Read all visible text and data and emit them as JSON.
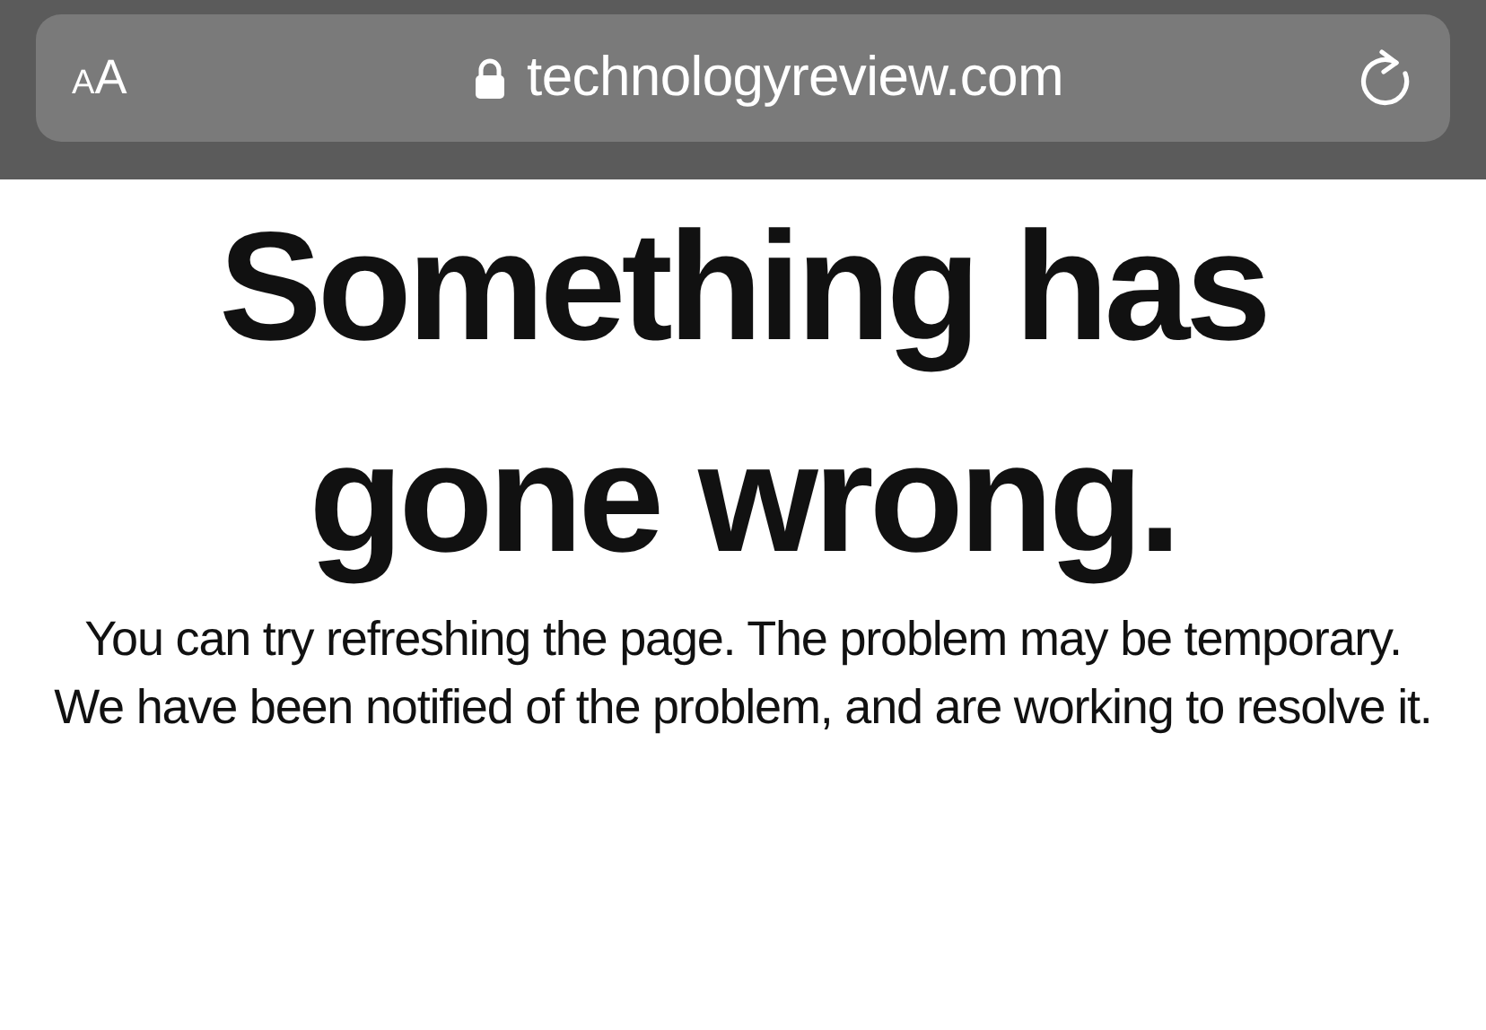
{
  "address_bar": {
    "text_size_button": "AA",
    "secure": true,
    "url": "technologyreview.com"
  },
  "error": {
    "heading": "Something has gone wrong.",
    "paragraphs": [
      "You can try refreshing the page. The problem may be temporary.",
      "We have been notified of the problem, and are working to resolve it."
    ]
  }
}
